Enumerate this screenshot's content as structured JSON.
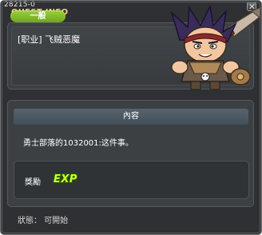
{
  "window": {
    "quest_id": "28215-0",
    "title": "QUEST INFO"
  },
  "quest": {
    "category": "一般",
    "name": "[职业] 飞贼恶魔"
  },
  "content": {
    "header": "內容",
    "description": "勇士部落的1032001:这件事。"
  },
  "reward": {
    "label": "獎勵",
    "exp_text": "EXP"
  },
  "status": "狀態： 可開始",
  "colors": {
    "title": "#ffd36a",
    "badge": "#86bd2e",
    "exp": "#c7ff2f",
    "window_bg": "#2e3033"
  }
}
